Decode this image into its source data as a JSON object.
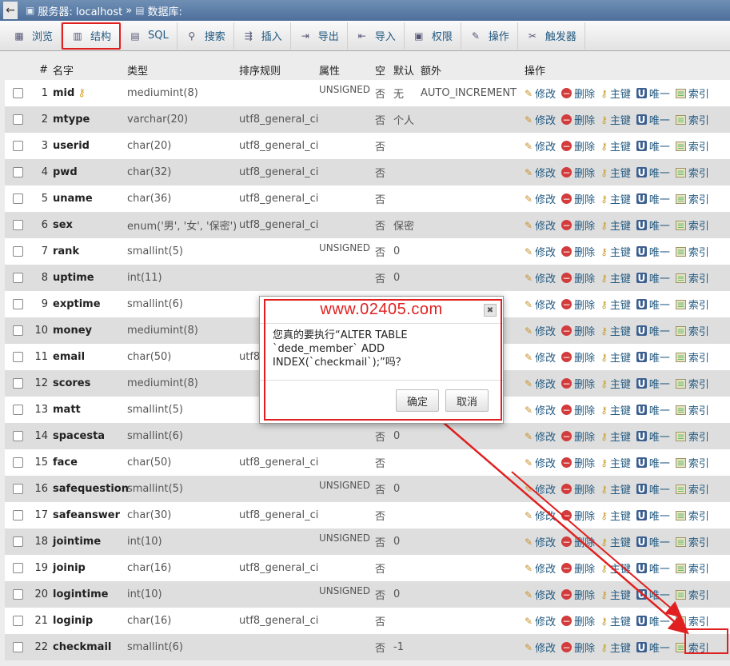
{
  "breadcrumb": {
    "back": "←",
    "server_label": "服务器: localhost",
    "separator": "»",
    "db_label": "数据库:"
  },
  "tabs": [
    {
      "label": "浏览",
      "icon": "table-icon",
      "glyph": "▦"
    },
    {
      "label": "结构",
      "icon": "structure-icon",
      "glyph": "▥"
    },
    {
      "label": "SQL",
      "icon": "sql-icon",
      "glyph": "▤"
    },
    {
      "label": "搜索",
      "icon": "search-icon",
      "glyph": "⚲"
    },
    {
      "label": "插入",
      "icon": "insert-icon",
      "glyph": "⇶"
    },
    {
      "label": "导出",
      "icon": "export-icon",
      "glyph": "⇥"
    },
    {
      "label": "导入",
      "icon": "import-icon",
      "glyph": "⇤"
    },
    {
      "label": "权限",
      "icon": "privileges-icon",
      "glyph": "▣"
    },
    {
      "label": "操作",
      "icon": "wrench-icon",
      "glyph": "✎"
    },
    {
      "label": "触发器",
      "icon": "trigger-icon",
      "glyph": "✂"
    }
  ],
  "active_tab": "结构",
  "columns": {
    "num": "#",
    "name": "名字",
    "type": "类型",
    "collation": "排序规则",
    "attributes": "属性",
    "null": "空",
    "default": "默认",
    "extra": "额外",
    "action": "操作"
  },
  "actions": {
    "edit": "修改",
    "drop": "删除",
    "primary": "主键",
    "unique": "唯一",
    "index": "索引"
  },
  "rows": [
    {
      "num": "1",
      "name": "mid",
      "type": "mediumint(8)",
      "collation": "",
      "attr": "UNSIGNED",
      "null": "否",
      "default": "无",
      "extra": "AUTO_INCREMENT",
      "primary": true
    },
    {
      "num": "2",
      "name": "mtype",
      "type": "varchar(20)",
      "collation": "utf8_general_ci",
      "attr": "",
      "null": "否",
      "default": "个人",
      "extra": ""
    },
    {
      "num": "3",
      "name": "userid",
      "type": "char(20)",
      "collation": "utf8_general_ci",
      "attr": "",
      "null": "否",
      "default": "",
      "extra": ""
    },
    {
      "num": "4",
      "name": "pwd",
      "type": "char(32)",
      "collation": "utf8_general_ci",
      "attr": "",
      "null": "否",
      "default": "",
      "extra": ""
    },
    {
      "num": "5",
      "name": "uname",
      "type": "char(36)",
      "collation": "utf8_general_ci",
      "attr": "",
      "null": "否",
      "default": "",
      "extra": ""
    },
    {
      "num": "6",
      "name": "sex",
      "type": "enum('男', '女', '保密')",
      "collation": "utf8_general_ci",
      "attr": "",
      "null": "否",
      "default": "保密",
      "extra": ""
    },
    {
      "num": "7",
      "name": "rank",
      "type": "smallint(5)",
      "collation": "",
      "attr": "UNSIGNED",
      "null": "否",
      "default": "0",
      "extra": ""
    },
    {
      "num": "8",
      "name": "uptime",
      "type": "int(11)",
      "collation": "",
      "attr": "",
      "null": "否",
      "default": "0",
      "extra": ""
    },
    {
      "num": "9",
      "name": "exptime",
      "type": "smallint(6)",
      "collation": "",
      "attr": "",
      "null": "",
      "default": "",
      "extra": ""
    },
    {
      "num": "10",
      "name": "money",
      "type": "mediumint(8)",
      "collation": "",
      "attr": "",
      "null": "",
      "default": "",
      "extra": ""
    },
    {
      "num": "11",
      "name": "email",
      "type": "char(50)",
      "collation": "utf8",
      "attr": "",
      "null": "",
      "default": "",
      "extra": ""
    },
    {
      "num": "12",
      "name": "scores",
      "type": "mediumint(8)",
      "collation": "",
      "attr": "",
      "null": "",
      "default": "",
      "extra": ""
    },
    {
      "num": "13",
      "name": "matt",
      "type": "smallint(5)",
      "collation": "",
      "attr": "",
      "null": "",
      "default": "",
      "extra": ""
    },
    {
      "num": "14",
      "name": "spacesta",
      "type": "smallint(6)",
      "collation": "",
      "attr": "",
      "null": "否",
      "default": "0",
      "extra": ""
    },
    {
      "num": "15",
      "name": "face",
      "type": "char(50)",
      "collation": "utf8_general_ci",
      "attr": "",
      "null": "否",
      "default": "",
      "extra": ""
    },
    {
      "num": "16",
      "name": "safequestion",
      "type": "smallint(5)",
      "collation": "",
      "attr": "UNSIGNED",
      "null": "否",
      "default": "0",
      "extra": ""
    },
    {
      "num": "17",
      "name": "safeanswer",
      "type": "char(30)",
      "collation": "utf8_general_ci",
      "attr": "",
      "null": "否",
      "default": "",
      "extra": ""
    },
    {
      "num": "18",
      "name": "jointime",
      "type": "int(10)",
      "collation": "",
      "attr": "UNSIGNED",
      "null": "否",
      "default": "0",
      "extra": ""
    },
    {
      "num": "19",
      "name": "joinip",
      "type": "char(16)",
      "collation": "utf8_general_ci",
      "attr": "",
      "null": "否",
      "default": "",
      "extra": ""
    },
    {
      "num": "20",
      "name": "logintime",
      "type": "int(10)",
      "collation": "",
      "attr": "UNSIGNED",
      "null": "否",
      "default": "0",
      "extra": ""
    },
    {
      "num": "21",
      "name": "loginip",
      "type": "char(16)",
      "collation": "utf8_general_ci",
      "attr": "",
      "null": "否",
      "default": "",
      "extra": ""
    },
    {
      "num": "22",
      "name": "checkmail",
      "type": "smallint(6)",
      "collation": "",
      "attr": "",
      "null": "否",
      "default": "-1",
      "extra": ""
    }
  ],
  "dialog": {
    "watermark": "www.02405.com",
    "close": "✖",
    "message": "您真的要执行“ALTER TABLE\n`dede_member` ADD\nINDEX(`checkmail`);”吗？",
    "ok": "确定",
    "cancel": "取消"
  },
  "highlight_color": "#e02020"
}
